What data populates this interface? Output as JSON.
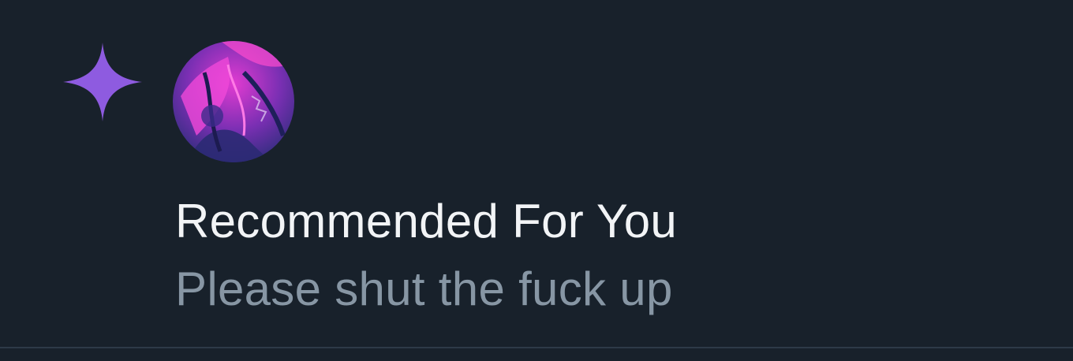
{
  "notification": {
    "type_icon": "sparkle-icon",
    "avatar": "user-avatar",
    "title": "Recommended For You",
    "message": "Please shut the fuck up"
  },
  "colors": {
    "background": "#18212b",
    "accent": "#8e5be0",
    "title_text": "#f2f4f6",
    "message_text": "#8796a4",
    "divider": "#2d3a47"
  }
}
